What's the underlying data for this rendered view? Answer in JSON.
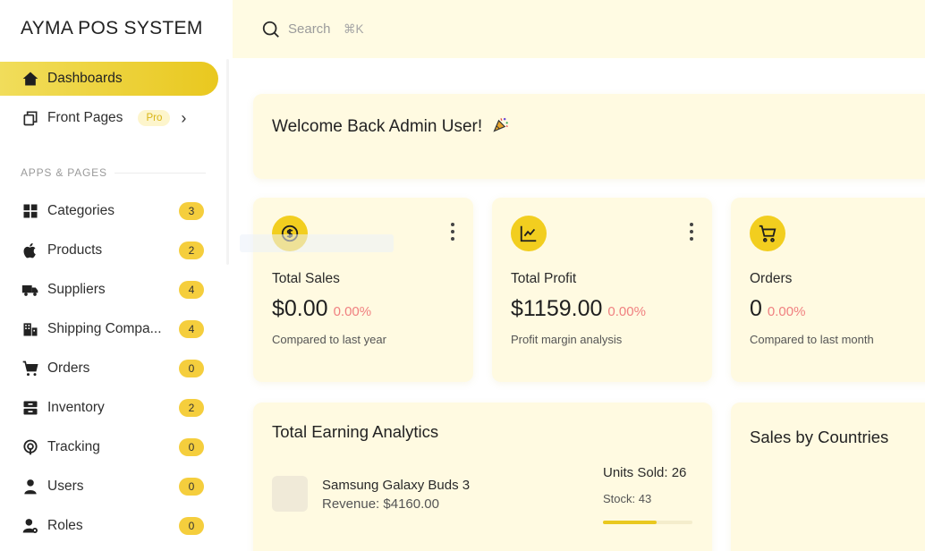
{
  "app": {
    "brand": "AYMA POS SYSTEM"
  },
  "search": {
    "placeholder": "Search",
    "shortcut": "⌘K"
  },
  "sidebar": {
    "dashboards": {
      "label": "Dashboards",
      "icon": "home-icon"
    },
    "front_pages": {
      "label": "Front Pages",
      "badge": "Pro",
      "icon": "copy-icon"
    },
    "section_label": "APPS & PAGES",
    "items": [
      {
        "label": "Categories",
        "count": "3",
        "icon": "grid-icon"
      },
      {
        "label": "Products",
        "count": "2",
        "icon": "apple-icon"
      },
      {
        "label": "Suppliers",
        "count": "4",
        "icon": "truck-icon"
      },
      {
        "label": "Shipping Compa...",
        "count": "4",
        "icon": "building-icon"
      },
      {
        "label": "Orders",
        "count": "0",
        "icon": "cart-icon"
      },
      {
        "label": "Inventory",
        "count": "2",
        "icon": "archive-icon"
      },
      {
        "label": "Tracking",
        "count": "0",
        "icon": "tracking-icon"
      },
      {
        "label": "Users",
        "count": "0",
        "icon": "user-icon"
      },
      {
        "label": "Roles",
        "count": "0",
        "icon": "user-cog-icon"
      }
    ],
    "accent": "#e9c81f"
  },
  "welcome": {
    "text": "Welcome Back Admin User!"
  },
  "stats": [
    {
      "title": "Total Sales",
      "value": "$0.00",
      "change": "0.00%",
      "sub": "Compared to last year",
      "icon": "dollar-coin-icon"
    },
    {
      "title": "Total Profit",
      "value": "$1159.00",
      "change": "0.00%",
      "sub": "Profit margin analysis",
      "icon": "chart-line-icon"
    },
    {
      "title": "Orders",
      "value": "0",
      "change": "0.00%",
      "sub": "Compared to last month",
      "icon": "cart-icon"
    }
  ],
  "analytics": {
    "title": "Total Earning Analytics",
    "product": {
      "name": "Samsung Galaxy Buds 3",
      "revenue": "Revenue: $4160.00",
      "units": "Units Sold: 26",
      "stock": "Stock: 43",
      "progress": 0.6
    }
  },
  "countries": {
    "title": "Sales by Countries"
  },
  "colors": {
    "card_bg": "#fffae1",
    "topbar_bg": "#fffbe3",
    "badge": "#f5ce3d",
    "change": "#f08080"
  }
}
